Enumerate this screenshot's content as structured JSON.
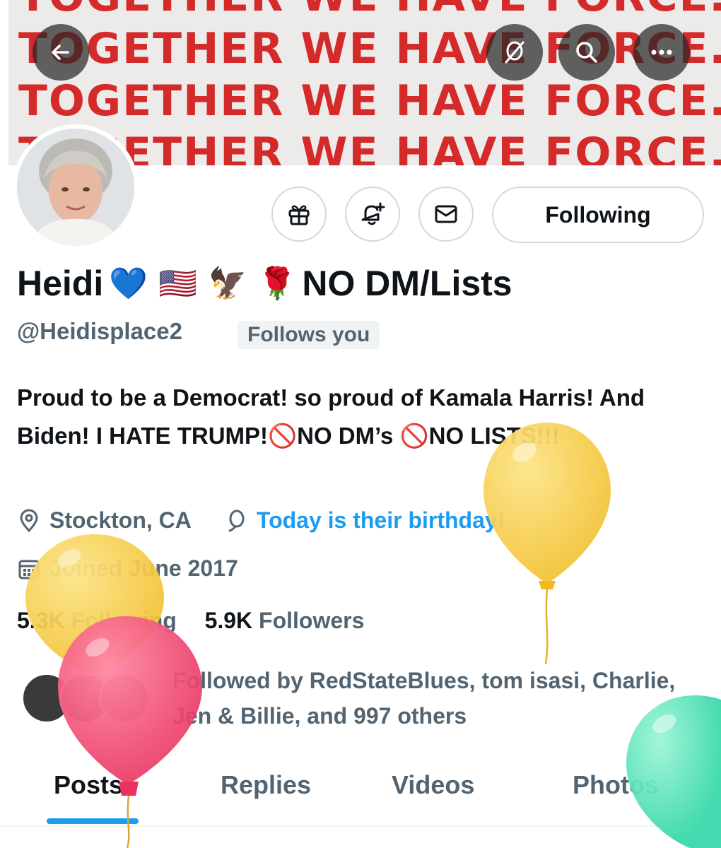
{
  "banner": {
    "lines": [
      "TOGETHER WE HAVE FORCE.",
      "TOGETHER WE HAVE FORCE.",
      "TOGETHER WE HAVE FORCE.",
      "TOGETHER WE HAVE FORCE."
    ]
  },
  "top_icons": [
    "back-arrow-icon",
    "balloon-off-icon",
    "search-icon",
    "more-icon"
  ],
  "actions": {
    "following_label": "Following",
    "icons": [
      "gift-icon",
      "bell-plus-icon",
      "mail-icon"
    ]
  },
  "profile": {
    "name": "Heidi",
    "name_emoji": "💙 🇺🇸 🦅 🌹",
    "name_suffix": "NO DM/Lists",
    "handle": "@Heidisplace2",
    "follows_you": "Follows you",
    "bio": "Proud to be a Democrat! so proud of Kamala Harris! And Biden! I HATE TRUMP!🚫NO DM’s 🚫NO LISTS!!!",
    "location": "Stockton, CA",
    "birthday": "Today is their birthday!",
    "joined": "Joined June 2017",
    "following_count": "5.3K",
    "following_label": "Following",
    "followers_count": "5.9K",
    "followers_label": "Followers",
    "followed_by": "Followed by RedStateBlues, tom isasi, Charlie, Jen & Billie, and 997 others"
  },
  "tabs": [
    {
      "label": "Posts",
      "active": true
    },
    {
      "label": "Replies",
      "active": false
    },
    {
      "label": "Videos",
      "active": false
    },
    {
      "label": "Photos",
      "active": false
    }
  ],
  "colors": {
    "accent": "#1d9bf0",
    "banner_text": "#d42a2a",
    "balloon_yellow": "#f7c948",
    "balloon_pink": "#f0436e",
    "balloon_green": "#3ee0b0"
  }
}
